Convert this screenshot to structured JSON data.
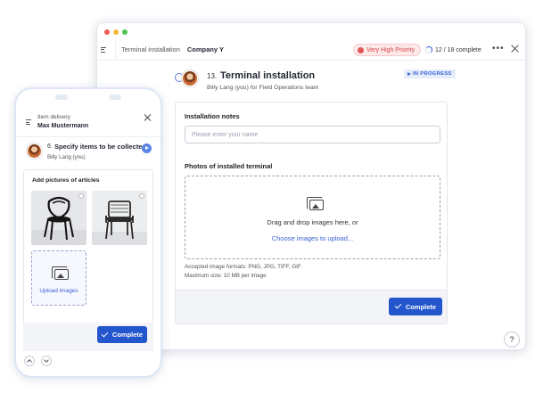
{
  "colors": {
    "accent": "#2355cc",
    "link": "#3a62d6",
    "priority": "#d64545"
  },
  "window": {
    "breadcrumb_task": "Terminal installation",
    "breadcrumb_company": "Company Y",
    "priority": "Very High Priority",
    "progress": "12 / 18 complete",
    "more_label": "•••",
    "task": {
      "number": "13.",
      "title": "Terminal installation",
      "assignee": "Billy Lang (you) for Field Operations team",
      "status": "IN PROGRESS"
    },
    "form": {
      "notes_label": "Installation notes",
      "notes_placeholder": "Please enter your name",
      "photos_label": "Photos of installed terminal",
      "drop_text": "Drag and drop images here, or",
      "drop_link": "Choose images to upload...",
      "formats_hint": "Accepted image formats: PNG, JPG, TIFF, GIF",
      "size_hint": "Maximum size: 10 MB per image",
      "complete_button": "Complete"
    },
    "help": "?"
  },
  "phone": {
    "title_small": "Item delivery",
    "title_name": "Max Mustermann",
    "task": {
      "number": "6.",
      "title": "Specify items to be collected",
      "assignee": "Billy Lang (you)"
    },
    "section_label": "Add pictures of articles",
    "upload_label": "Upload images",
    "complete_button": "Complete"
  }
}
